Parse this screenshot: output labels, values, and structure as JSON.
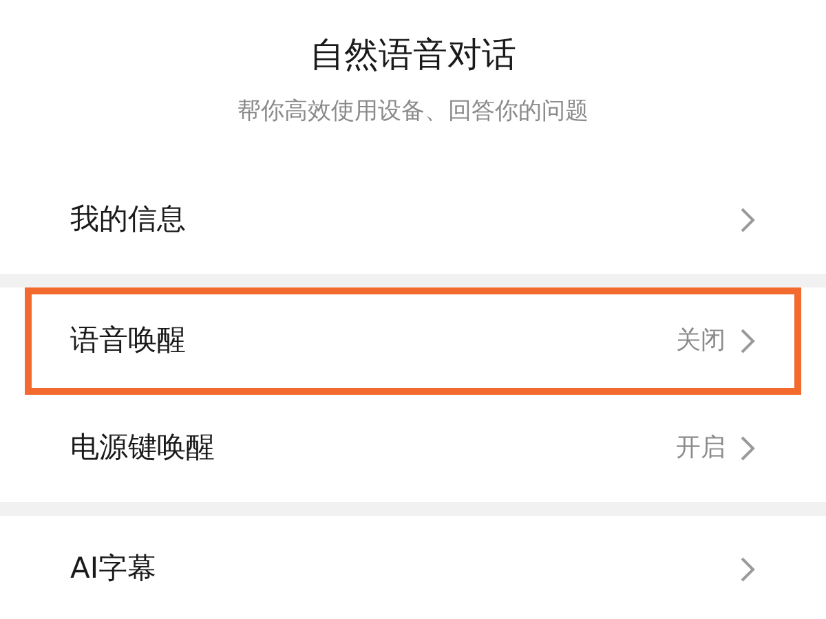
{
  "header": {
    "title": "自然语音对话",
    "subtitle": "帮你高效使用设备、回答你的问题"
  },
  "groups": [
    {
      "rows": [
        {
          "label": "我的信息",
          "highlighted": false
        }
      ]
    },
    {
      "rows": [
        {
          "label": "语音唤醒",
          "value": "关闭",
          "highlighted": true
        },
        {
          "label": "电源键唤醒",
          "value": "开启",
          "highlighted": false
        }
      ]
    },
    {
      "rows": [
        {
          "label": "AI字幕",
          "highlighted": false
        }
      ]
    }
  ]
}
